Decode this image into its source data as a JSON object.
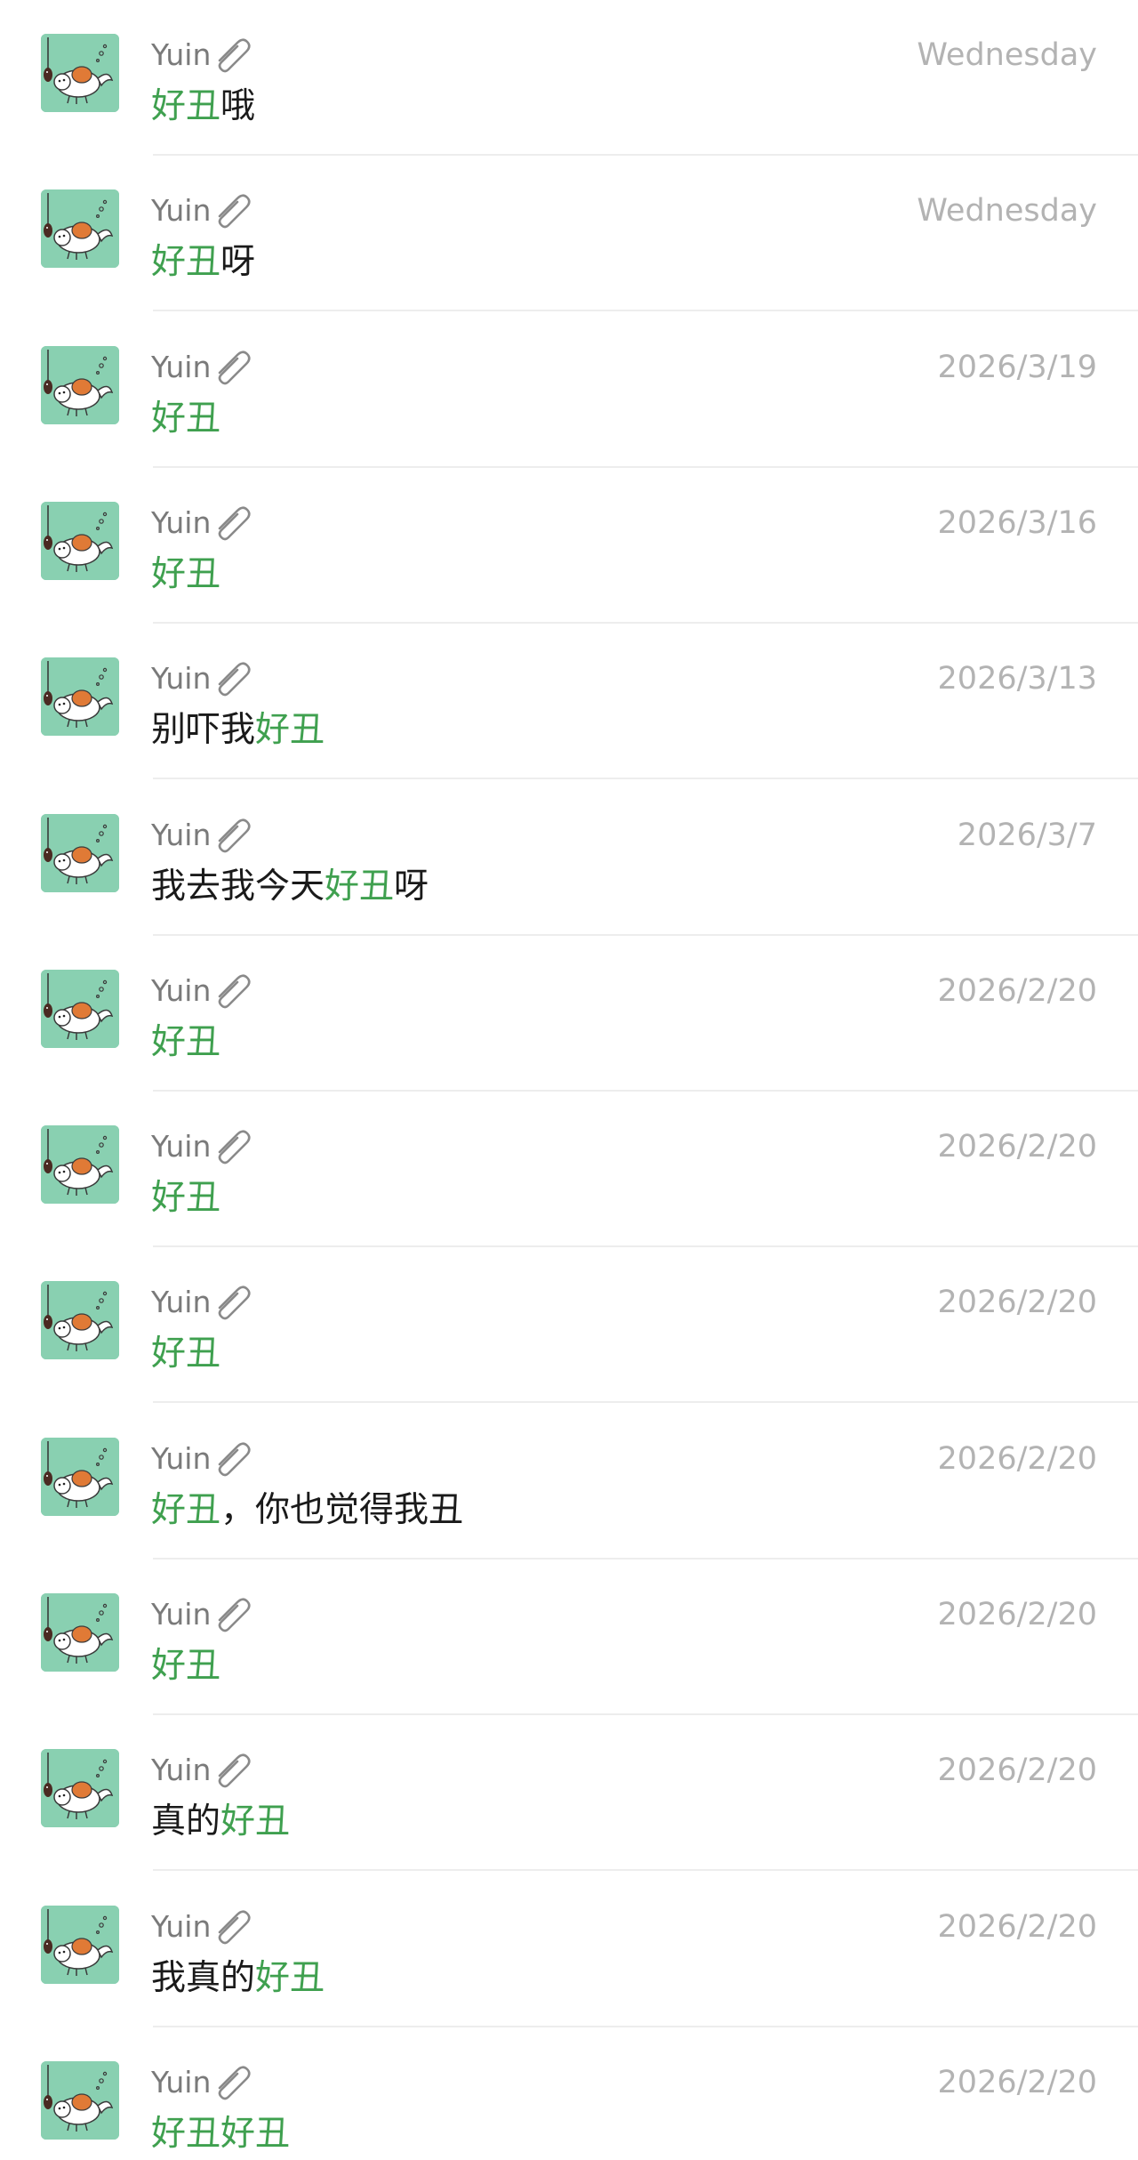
{
  "colors": {
    "highlight": "#3fa04f",
    "name": "#7a7a7a",
    "time": "#b3b3b3",
    "text": "#1a1a1a",
    "avatar_bg": "#8fd3b6",
    "divider": "#ededed"
  },
  "icons": {
    "avatar": "avatar-fish-cat",
    "attachment": "paperclip-icon"
  },
  "results": [
    {
      "name": "Yuin",
      "time": "Wednesday",
      "segments": [
        {
          "text": "好丑",
          "hl": true
        },
        {
          "text": "哦",
          "hl": false
        }
      ]
    },
    {
      "name": "Yuin",
      "time": "Wednesday",
      "segments": [
        {
          "text": "好丑",
          "hl": true
        },
        {
          "text": "呀",
          "hl": false
        }
      ]
    },
    {
      "name": "Yuin",
      "time": "2026/3/19",
      "segments": [
        {
          "text": "好丑",
          "hl": true
        }
      ]
    },
    {
      "name": "Yuin",
      "time": "2026/3/16",
      "segments": [
        {
          "text": "好丑",
          "hl": true
        }
      ]
    },
    {
      "name": "Yuin",
      "time": "2026/3/13",
      "segments": [
        {
          "text": "别吓我",
          "hl": false
        },
        {
          "text": "好丑",
          "hl": true
        }
      ]
    },
    {
      "name": "Yuin",
      "time": "2026/3/7",
      "segments": [
        {
          "text": "我去我今天",
          "hl": false
        },
        {
          "text": "好丑",
          "hl": true
        },
        {
          "text": "呀",
          "hl": false
        }
      ]
    },
    {
      "name": "Yuin",
      "time": "2026/2/20",
      "segments": [
        {
          "text": "好丑",
          "hl": true
        }
      ]
    },
    {
      "name": "Yuin",
      "time": "2026/2/20",
      "segments": [
        {
          "text": "好丑",
          "hl": true
        }
      ]
    },
    {
      "name": "Yuin",
      "time": "2026/2/20",
      "segments": [
        {
          "text": "好丑",
          "hl": true
        }
      ]
    },
    {
      "name": "Yuin",
      "time": "2026/2/20",
      "segments": [
        {
          "text": "好丑",
          "hl": true
        },
        {
          "text": "，你也觉得我丑",
          "hl": false
        }
      ]
    },
    {
      "name": "Yuin",
      "time": "2026/2/20",
      "segments": [
        {
          "text": "好丑",
          "hl": true
        }
      ]
    },
    {
      "name": "Yuin",
      "time": "2026/2/20",
      "segments": [
        {
          "text": "真的",
          "hl": false
        },
        {
          "text": "好丑",
          "hl": true
        }
      ]
    },
    {
      "name": "Yuin",
      "time": "2026/2/20",
      "segments": [
        {
          "text": "我真的",
          "hl": false
        },
        {
          "text": "好丑",
          "hl": true
        }
      ]
    },
    {
      "name": "Yuin",
      "time": "2026/2/20",
      "segments": [
        {
          "text": "好丑好丑",
          "hl": true
        }
      ]
    }
  ]
}
